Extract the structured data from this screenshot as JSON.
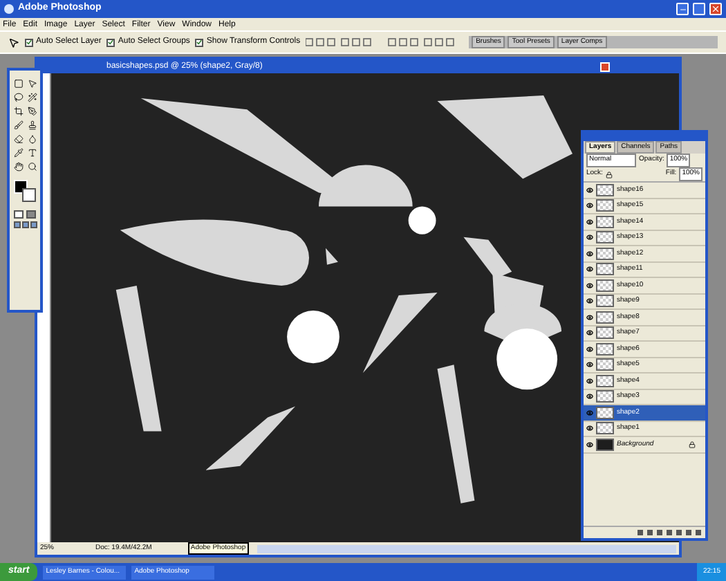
{
  "window": {
    "title": "Adobe Photoshop"
  },
  "menu": [
    "File",
    "Edit",
    "Image",
    "Layer",
    "Select",
    "Filter",
    "View",
    "Window",
    "Help"
  ],
  "options_bar": {
    "checkboxes": [
      {
        "label": "Auto Select Layer",
        "checked": true
      },
      {
        "label": "Auto Select Groups",
        "checked": true
      },
      {
        "label": "Show Transform Controls",
        "checked": true
      }
    ],
    "palette_tabs": [
      "Brushes",
      "Tool Presets",
      "Layer Comps"
    ]
  },
  "document": {
    "title": "basicshapes.psd @ 25% (shape2, Gray/8)",
    "zoom": "25%",
    "doc_size": "Doc: 19.4M/42.2M",
    "tooltip": "Adobe Photoshop"
  },
  "layers_panel": {
    "tabs": [
      {
        "label": "Layers",
        "selected": true
      },
      {
        "label": "Channels",
        "selected": false
      },
      {
        "label": "Paths",
        "selected": false
      }
    ],
    "blend_mode": "Normal",
    "opacity_label": "Opacity:",
    "opacity": "100%",
    "lock_label": "Lock:",
    "fill_label": "Fill:",
    "fill": "100%",
    "layers": [
      {
        "name": "shape16",
        "kind": "shape",
        "visible": true,
        "selected": false,
        "locked": false
      },
      {
        "name": "shape15",
        "kind": "shape",
        "visible": true,
        "selected": false,
        "locked": false
      },
      {
        "name": "shape14",
        "kind": "shape",
        "visible": true,
        "selected": false,
        "locked": false
      },
      {
        "name": "shape13",
        "kind": "shape",
        "visible": true,
        "selected": false,
        "locked": false
      },
      {
        "name": "shape12",
        "kind": "shape",
        "visible": true,
        "selected": false,
        "locked": false
      },
      {
        "name": "shape11",
        "kind": "shape",
        "visible": true,
        "selected": false,
        "locked": false
      },
      {
        "name": "shape10",
        "kind": "shape",
        "visible": true,
        "selected": false,
        "locked": false
      },
      {
        "name": "shape9",
        "kind": "shape",
        "visible": true,
        "selected": false,
        "locked": false
      },
      {
        "name": "shape8",
        "kind": "shape",
        "visible": true,
        "selected": false,
        "locked": false
      },
      {
        "name": "shape7",
        "kind": "shape",
        "visible": true,
        "selected": false,
        "locked": false
      },
      {
        "name": "shape6",
        "kind": "shape",
        "visible": true,
        "selected": false,
        "locked": false
      },
      {
        "name": "shape5",
        "kind": "shape",
        "visible": true,
        "selected": false,
        "locked": false
      },
      {
        "name": "shape4",
        "kind": "shape",
        "visible": true,
        "selected": false,
        "locked": false
      },
      {
        "name": "shape3",
        "kind": "shape",
        "visible": true,
        "selected": false,
        "locked": false
      },
      {
        "name": "shape2",
        "kind": "shape",
        "visible": true,
        "selected": true,
        "locked": false
      },
      {
        "name": "shape1",
        "kind": "shape",
        "visible": true,
        "selected": false,
        "locked": false
      },
      {
        "name": "Background",
        "kind": "background",
        "visible": true,
        "selected": false,
        "locked": true
      }
    ]
  },
  "taskbar": {
    "start": "start",
    "tasks": [
      "Lesley Barnes - Colou...",
      "Adobe Photoshop"
    ],
    "clock": "22:15"
  }
}
